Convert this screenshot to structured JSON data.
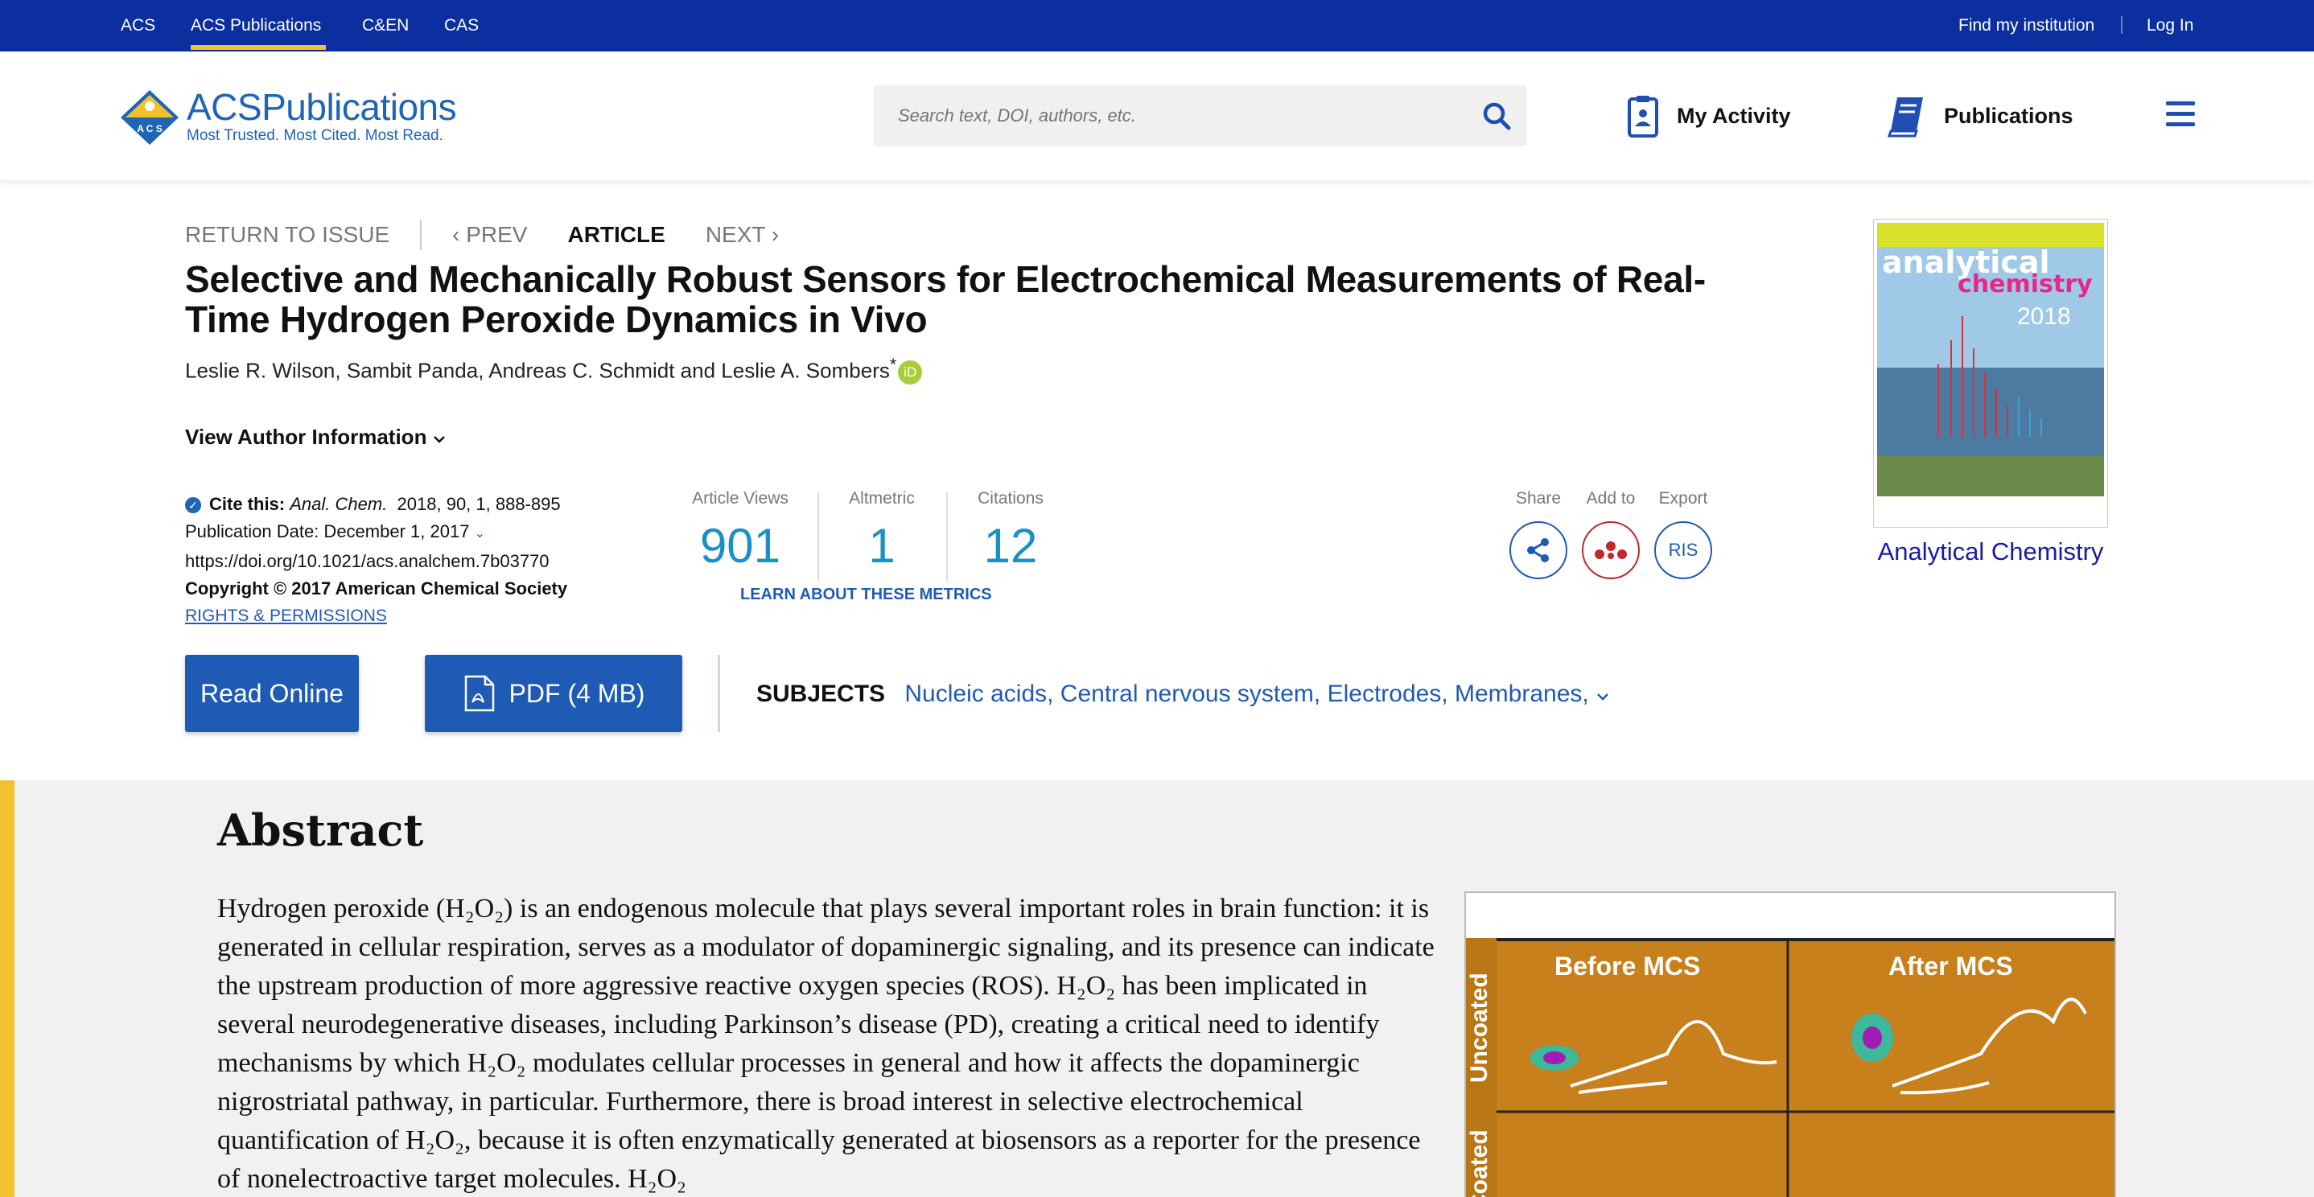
{
  "topnav": {
    "links": [
      "ACS",
      "ACS Publications",
      "C&EN",
      "CAS"
    ],
    "find_institution": "Find my institution",
    "login": "Log In"
  },
  "header": {
    "logo_acs": "ACS",
    "logo_pubs": "Publications",
    "logo_tagline": "Most Trusted. Most Cited. Most Read.",
    "search_placeholder": "Search text, DOI, authors, etc.",
    "my_activity": "My Activity",
    "publications": "Publications"
  },
  "article_nav": {
    "return": "RETURN TO ISSUE",
    "prev": "PREV",
    "current": "ARTICLE",
    "next": "NEXT"
  },
  "article": {
    "title": "Selective and Mechanically Robust Sensors for Electrochemical Measurements of Real-Time Hydrogen Peroxide Dynamics in Vivo",
    "authors": [
      "Leslie R. Wilson,",
      "Sambit Panda,",
      "Andreas C. Schmidt",
      "and",
      "Leslie A. Sombers"
    ],
    "corresponding_mark": "*",
    "view_author_info": "View Author Information"
  },
  "citation": {
    "cite_label": "Cite this:",
    "journal": "Anal. Chem.",
    "ref": "2018, 90, 1, 888-895",
    "pub_date": "Publication Date: December 1, 2017",
    "doi": "https://doi.org/10.1021/acs.analchem.7b03770",
    "copyright": "Copyright © 2017 American Chemical Society",
    "rights": "RIGHTS & PERMISSIONS"
  },
  "metrics": {
    "views_label": "Article Views",
    "views": "901",
    "altmetric_label": "Altmetric",
    "altmetric": "1",
    "citations_label": "Citations",
    "citations": "12",
    "learn": "LEARN ABOUT THESE METRICS"
  },
  "tools": {
    "share": "Share",
    "add_to": "Add to",
    "export": "Export",
    "ris": "RIS"
  },
  "actions": {
    "read_online": "Read Online",
    "pdf": "PDF (4 MB)"
  },
  "subjects": {
    "label": "SUBJECTS",
    "value": "Nucleic acids, Central nervous system, Electrodes, Membranes,"
  },
  "journal_cover": {
    "link": "Analytical Chemistry",
    "cover_title_1": "analytical",
    "cover_title_2": "chemistry",
    "cover_year": "2018"
  },
  "abstract": {
    "heading": "Abstract",
    "text": "Hydrogen peroxide (H₂O₂) is an endogenous molecule that plays several important roles in brain function: it is generated in cellular respiration, serves as a modulator of dopaminergic signaling, and its presence can indicate the upstream production of more aggressive reactive oxygen species (ROS). H₂O₂ has been implicated in several neurodegenerative diseases, including Parkinson’s disease (PD), creating a critical need to identify mechanisms by which H₂O₂ modulates cellular processes in general and how it affects the dopaminergic nigrostriatal pathway, in particular. Furthermore, there is broad interest in selective electrochemical quantification of H₂O₂, because it is often enzymatically generated at biosensors as a reporter for the presence of nonelectroactive target molecules. H₂O₂",
    "toc_before": "Before MCS",
    "toc_after": "After MCS",
    "toc_uncoated": "Uncoated",
    "toc_coated": "Coated"
  },
  "colors": {
    "top_bar": "#0b2f9e",
    "accent_yellow": "#f2c12e",
    "link_blue": "#1f5bb5",
    "metric_blue": "#1a90c9"
  }
}
